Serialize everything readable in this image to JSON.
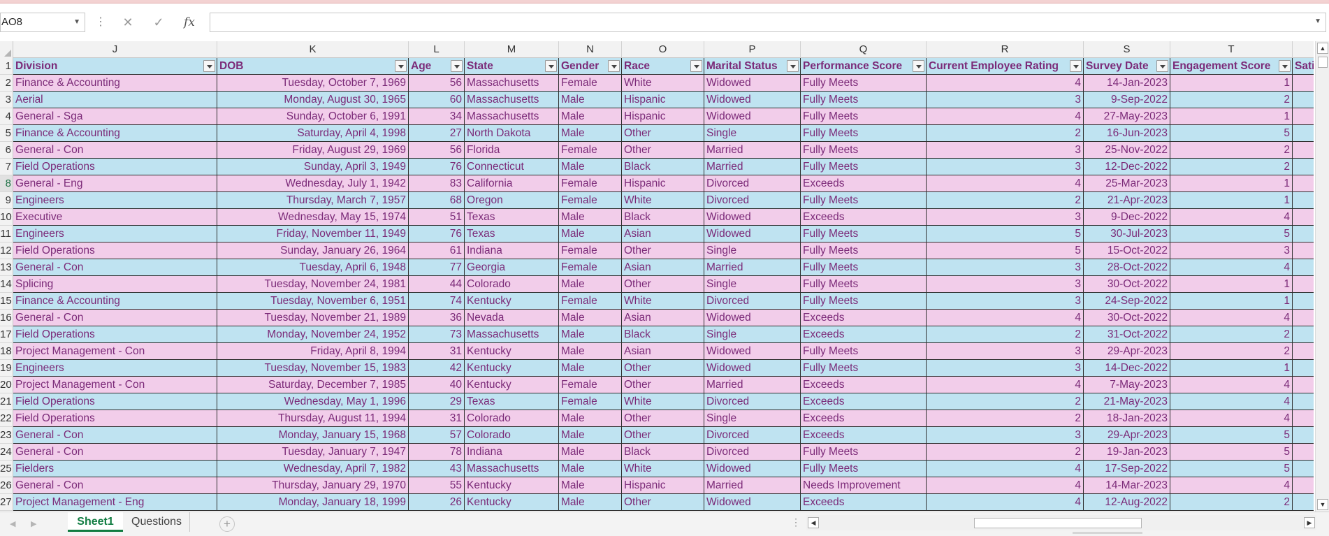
{
  "namebox": {
    "value": "AO8"
  },
  "formula_bar": {
    "cancel_icon": "✕",
    "enter_icon": "✓",
    "fx_label": "fx",
    "value": ""
  },
  "columns": [
    "J",
    "K",
    "L",
    "M",
    "N",
    "O",
    "P",
    "Q",
    "R",
    "S",
    "T",
    ""
  ],
  "headers": [
    "Division",
    "DOB",
    "Age",
    "State",
    "Gender",
    "Race",
    "Marital Status",
    "Performance Score",
    "Current Employee Rating",
    "Survey Date",
    "Engagement Score",
    "Sati"
  ],
  "rows": [
    {
      "num": "2",
      "cells": [
        "Finance & Accounting",
        "Tuesday, October 7, 1969",
        "56",
        "Massachusetts",
        "Female",
        "White",
        "Widowed",
        "Fully Meets",
        "4",
        "14-Jan-2023",
        "1",
        ""
      ]
    },
    {
      "num": "3",
      "cells": [
        "Aerial",
        "Monday, August 30, 1965",
        "60",
        "Massachusetts",
        "Male",
        "Hispanic",
        "Widowed",
        "Fully Meets",
        "3",
        "9-Sep-2022",
        "2",
        ""
      ]
    },
    {
      "num": "4",
      "cells": [
        "General - Sga",
        "Sunday, October 6, 1991",
        "34",
        "Massachusetts",
        "Male",
        "Hispanic",
        "Widowed",
        "Fully Meets",
        "4",
        "27-May-2023",
        "1",
        ""
      ]
    },
    {
      "num": "5",
      "cells": [
        "Finance & Accounting",
        "Saturday, April 4, 1998",
        "27",
        "North Dakota",
        "Male",
        "Other",
        "Single",
        "Fully Meets",
        "2",
        "16-Jun-2023",
        "5",
        ""
      ]
    },
    {
      "num": "6",
      "cells": [
        "General - Con",
        "Friday, August 29, 1969",
        "56",
        "Florida",
        "Female",
        "Other",
        "Married",
        "Fully Meets",
        "3",
        "25-Nov-2022",
        "2",
        ""
      ]
    },
    {
      "num": "7",
      "cells": [
        "Field Operations",
        "Sunday, April 3, 1949",
        "76",
        "Connecticut",
        "Male",
        "Black",
        "Married",
        "Fully Meets",
        "3",
        "12-Dec-2022",
        "2",
        ""
      ]
    },
    {
      "num": "8",
      "cells": [
        "General - Eng",
        "Wednesday, July 1, 1942",
        "83",
        "California",
        "Female",
        "Hispanic",
        "Divorced",
        "Exceeds",
        "4",
        "25-Mar-2023",
        "1",
        ""
      ]
    },
    {
      "num": "9",
      "cells": [
        "Engineers",
        "Thursday, March 7, 1957",
        "68",
        "Oregon",
        "Female",
        "White",
        "Divorced",
        "Fully Meets",
        "2",
        "21-Apr-2023",
        "1",
        ""
      ]
    },
    {
      "num": "10",
      "cells": [
        "Executive",
        "Wednesday, May 15, 1974",
        "51",
        "Texas",
        "Male",
        "Black",
        "Widowed",
        "Exceeds",
        "3",
        "9-Dec-2022",
        "4",
        ""
      ]
    },
    {
      "num": "11",
      "cells": [
        "Engineers",
        "Friday, November 11, 1949",
        "76",
        "Texas",
        "Male",
        "Asian",
        "Widowed",
        "Fully Meets",
        "5",
        "30-Jul-2023",
        "5",
        ""
      ]
    },
    {
      "num": "12",
      "cells": [
        "Field Operations",
        "Sunday, January 26, 1964",
        "61",
        "Indiana",
        "Female",
        "Other",
        "Single",
        "Fully Meets",
        "5",
        "15-Oct-2022",
        "3",
        ""
      ]
    },
    {
      "num": "13",
      "cells": [
        "General - Con",
        "Tuesday, April 6, 1948",
        "77",
        "Georgia",
        "Female",
        "Asian",
        "Married",
        "Fully Meets",
        "3",
        "28-Oct-2022",
        "4",
        ""
      ]
    },
    {
      "num": "14",
      "cells": [
        "Splicing",
        "Tuesday, November 24, 1981",
        "44",
        "Colorado",
        "Male",
        "Other",
        "Single",
        "Fully Meets",
        "3",
        "30-Oct-2022",
        "1",
        ""
      ]
    },
    {
      "num": "15",
      "cells": [
        "Finance & Accounting",
        "Tuesday, November 6, 1951",
        "74",
        "Kentucky",
        "Female",
        "White",
        "Divorced",
        "Fully Meets",
        "3",
        "24-Sep-2022",
        "1",
        ""
      ]
    },
    {
      "num": "16",
      "cells": [
        "General - Con",
        "Tuesday, November 21, 1989",
        "36",
        "Nevada",
        "Male",
        "Asian",
        "Widowed",
        "Exceeds",
        "4",
        "30-Oct-2022",
        "4",
        ""
      ]
    },
    {
      "num": "17",
      "cells": [
        "Field Operations",
        "Monday, November 24, 1952",
        "73",
        "Massachusetts",
        "Male",
        "Black",
        "Single",
        "Exceeds",
        "2",
        "31-Oct-2022",
        "2",
        ""
      ]
    },
    {
      "num": "18",
      "cells": [
        "Project Management - Con",
        "Friday, April 8, 1994",
        "31",
        "Kentucky",
        "Male",
        "Asian",
        "Widowed",
        "Fully Meets",
        "3",
        "29-Apr-2023",
        "2",
        ""
      ]
    },
    {
      "num": "19",
      "cells": [
        "Engineers",
        "Tuesday, November 15, 1983",
        "42",
        "Kentucky",
        "Male",
        "Other",
        "Widowed",
        "Fully Meets",
        "3",
        "14-Dec-2022",
        "1",
        ""
      ]
    },
    {
      "num": "20",
      "cells": [
        "Project Management - Con",
        "Saturday, December 7, 1985",
        "40",
        "Kentucky",
        "Female",
        "Other",
        "Married",
        "Exceeds",
        "4",
        "7-May-2023",
        "4",
        ""
      ]
    },
    {
      "num": "21",
      "cells": [
        "Field Operations",
        "Wednesday, May 1, 1996",
        "29",
        "Texas",
        "Female",
        "White",
        "Divorced",
        "Exceeds",
        "2",
        "21-May-2023",
        "4",
        ""
      ]
    },
    {
      "num": "22",
      "cells": [
        "Field Operations",
        "Thursday, August 11, 1994",
        "31",
        "Colorado",
        "Male",
        "Other",
        "Single",
        "Exceeds",
        "2",
        "18-Jan-2023",
        "4",
        ""
      ]
    },
    {
      "num": "23",
      "cells": [
        "General - Con",
        "Monday, January 15, 1968",
        "57",
        "Colorado",
        "Male",
        "Other",
        "Divorced",
        "Exceeds",
        "3",
        "29-Apr-2023",
        "5",
        ""
      ]
    },
    {
      "num": "24",
      "cells": [
        "General - Con",
        "Tuesday, January 7, 1947",
        "78",
        "Indiana",
        "Male",
        "Black",
        "Divorced",
        "Fully Meets",
        "2",
        "19-Jan-2023",
        "5",
        ""
      ]
    },
    {
      "num": "25",
      "cells": [
        "Fielders",
        "Wednesday, April 7, 1982",
        "43",
        "Massachusetts",
        "Male",
        "White",
        "Widowed",
        "Fully Meets",
        "4",
        "17-Sep-2022",
        "5",
        ""
      ]
    },
    {
      "num": "26",
      "cells": [
        "General - Con",
        "Thursday, January 29, 1970",
        "55",
        "Kentucky",
        "Male",
        "Hispanic",
        "Married",
        "Needs Improvement",
        "4",
        "14-Mar-2023",
        "4",
        ""
      ]
    },
    {
      "num": "27",
      "cells": [
        "Project Management - Eng",
        "Monday, January 18, 1999",
        "26",
        "Kentucky",
        "Male",
        "Other",
        "Widowed",
        "Exceeds",
        "4",
        "12-Aug-2022",
        "2",
        ""
      ]
    }
  ],
  "sheet_tabs": [
    {
      "label": "Sheet1",
      "active": true
    },
    {
      "label": "Questions",
      "active": false
    }
  ],
  "add_sheet_label": "+",
  "colors": {
    "row_blue": "#bfe3f1",
    "row_pink": "#f2cdea",
    "text": "#7b2a78",
    "active_tab": "#107c41"
  }
}
